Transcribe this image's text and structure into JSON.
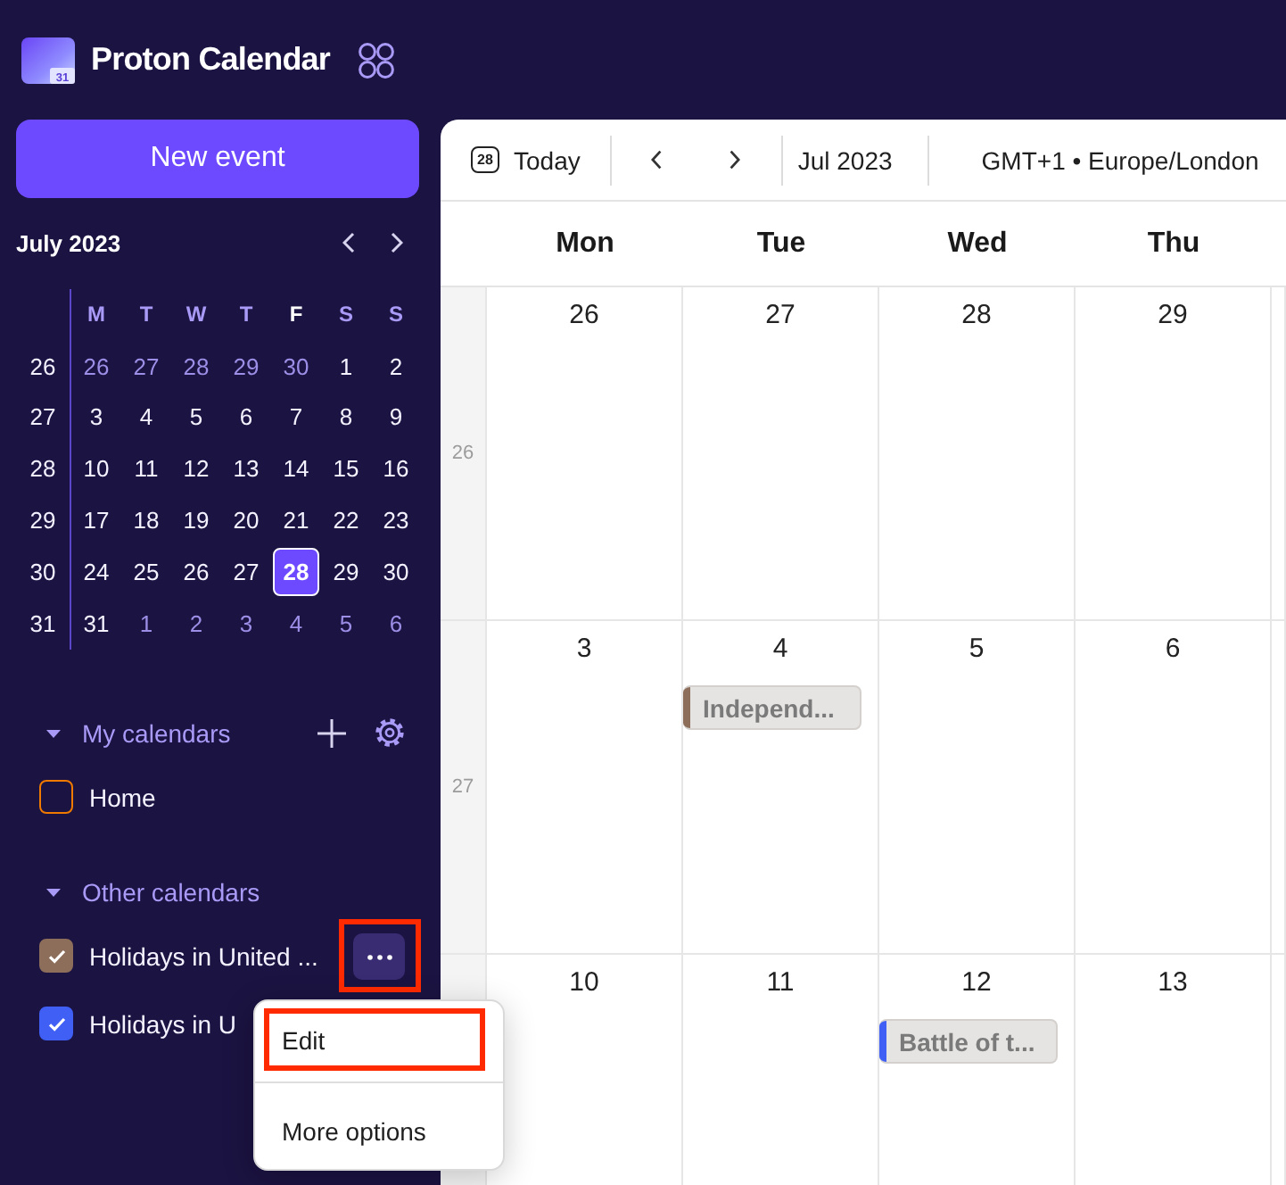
{
  "app": {
    "name": "Proton Calendar",
    "logo_date": "31"
  },
  "new_event_button": "New event",
  "mini_calendar": {
    "title": "July 2023",
    "weekdays": [
      {
        "label": "M",
        "today": false
      },
      {
        "label": "T",
        "today": false
      },
      {
        "label": "W",
        "today": false
      },
      {
        "label": "T",
        "today": false
      },
      {
        "label": "F",
        "today": true
      },
      {
        "label": "S",
        "today": false
      },
      {
        "label": "S",
        "today": false
      }
    ],
    "weeks": [
      {
        "number": "26",
        "days": [
          {
            "label": "26",
            "outside": true,
            "selected": false
          },
          {
            "label": "27",
            "outside": true,
            "selected": false
          },
          {
            "label": "28",
            "outside": true,
            "selected": false
          },
          {
            "label": "29",
            "outside": true,
            "selected": false
          },
          {
            "label": "30",
            "outside": true,
            "selected": false
          },
          {
            "label": "1",
            "outside": false,
            "selected": false
          },
          {
            "label": "2",
            "outside": false,
            "selected": false
          }
        ]
      },
      {
        "number": "27",
        "days": [
          {
            "label": "3",
            "outside": false,
            "selected": false
          },
          {
            "label": "4",
            "outside": false,
            "selected": false
          },
          {
            "label": "5",
            "outside": false,
            "selected": false
          },
          {
            "label": "6",
            "outside": false,
            "selected": false
          },
          {
            "label": "7",
            "outside": false,
            "selected": false
          },
          {
            "label": "8",
            "outside": false,
            "selected": false
          },
          {
            "label": "9",
            "outside": false,
            "selected": false
          }
        ]
      },
      {
        "number": "28",
        "days": [
          {
            "label": "10",
            "outside": false,
            "selected": false
          },
          {
            "label": "11",
            "outside": false,
            "selected": false
          },
          {
            "label": "12",
            "outside": false,
            "selected": false
          },
          {
            "label": "13",
            "outside": false,
            "selected": false
          },
          {
            "label": "14",
            "outside": false,
            "selected": false
          },
          {
            "label": "15",
            "outside": false,
            "selected": false
          },
          {
            "label": "16",
            "outside": false,
            "selected": false
          }
        ]
      },
      {
        "number": "29",
        "days": [
          {
            "label": "17",
            "outside": false,
            "selected": false
          },
          {
            "label": "18",
            "outside": false,
            "selected": false
          },
          {
            "label": "19",
            "outside": false,
            "selected": false
          },
          {
            "label": "20",
            "outside": false,
            "selected": false
          },
          {
            "label": "21",
            "outside": false,
            "selected": false
          },
          {
            "label": "22",
            "outside": false,
            "selected": false
          },
          {
            "label": "23",
            "outside": false,
            "selected": false
          }
        ]
      },
      {
        "number": "30",
        "days": [
          {
            "label": "24",
            "outside": false,
            "selected": false
          },
          {
            "label": "25",
            "outside": false,
            "selected": false
          },
          {
            "label": "26",
            "outside": false,
            "selected": false
          },
          {
            "label": "27",
            "outside": false,
            "selected": false
          },
          {
            "label": "28",
            "outside": false,
            "selected": true
          },
          {
            "label": "29",
            "outside": false,
            "selected": false
          },
          {
            "label": "30",
            "outside": false,
            "selected": false
          }
        ]
      },
      {
        "number": "31",
        "days": [
          {
            "label": "31",
            "outside": false,
            "selected": false
          },
          {
            "label": "1",
            "outside": true,
            "selected": false
          },
          {
            "label": "2",
            "outside": true,
            "selected": false
          },
          {
            "label": "3",
            "outside": true,
            "selected": false
          },
          {
            "label": "4",
            "outside": true,
            "selected": false
          },
          {
            "label": "5",
            "outside": true,
            "selected": false
          },
          {
            "label": "6",
            "outside": true,
            "selected": false
          }
        ]
      }
    ]
  },
  "my_calendars": {
    "title": "My calendars",
    "expanded": true,
    "items": [
      {
        "name": "Home",
        "checked": false,
        "color": "#f07a00"
      }
    ]
  },
  "other_calendars": {
    "title": "Other calendars",
    "expanded": true,
    "items": [
      {
        "name": "Holidays in United ...",
        "checked": true,
        "color": "#8d6e5a",
        "more_button": {
          "highlighted": true
        }
      },
      {
        "name": "Holidays in U",
        "checked": true,
        "color": "#3f5ff5"
      }
    ]
  },
  "toolbar": {
    "today_icon_date": "28",
    "today": "Today",
    "month": "Jul 2023",
    "timezone": "GMT+1 • Europe/London"
  },
  "calendar": {
    "weekdays": [
      "Mon",
      "Tue",
      "Wed",
      "Thu"
    ],
    "weeks": [
      {
        "number": "26",
        "days": [
          {
            "date": "26"
          },
          {
            "date": "27"
          },
          {
            "date": "28"
          },
          {
            "date": "29"
          }
        ]
      },
      {
        "number": "27",
        "days": [
          {
            "date": "3"
          },
          {
            "date": "4",
            "events": [
              {
                "title": "Independ...",
                "color": "#8d6e5a"
              }
            ]
          },
          {
            "date": "5"
          },
          {
            "date": "6"
          }
        ]
      },
      {
        "days": [
          {
            "date": "10"
          },
          {
            "date": "11"
          },
          {
            "date": "12",
            "events": [
              {
                "title": "Battle of t...",
                "color": "#3f5ff5"
              }
            ]
          },
          {
            "date": "13"
          }
        ]
      }
    ]
  },
  "context_menu": {
    "items": [
      {
        "label": "Edit",
        "highlighted": true
      },
      {
        "label": "More options",
        "highlighted": false
      }
    ]
  }
}
